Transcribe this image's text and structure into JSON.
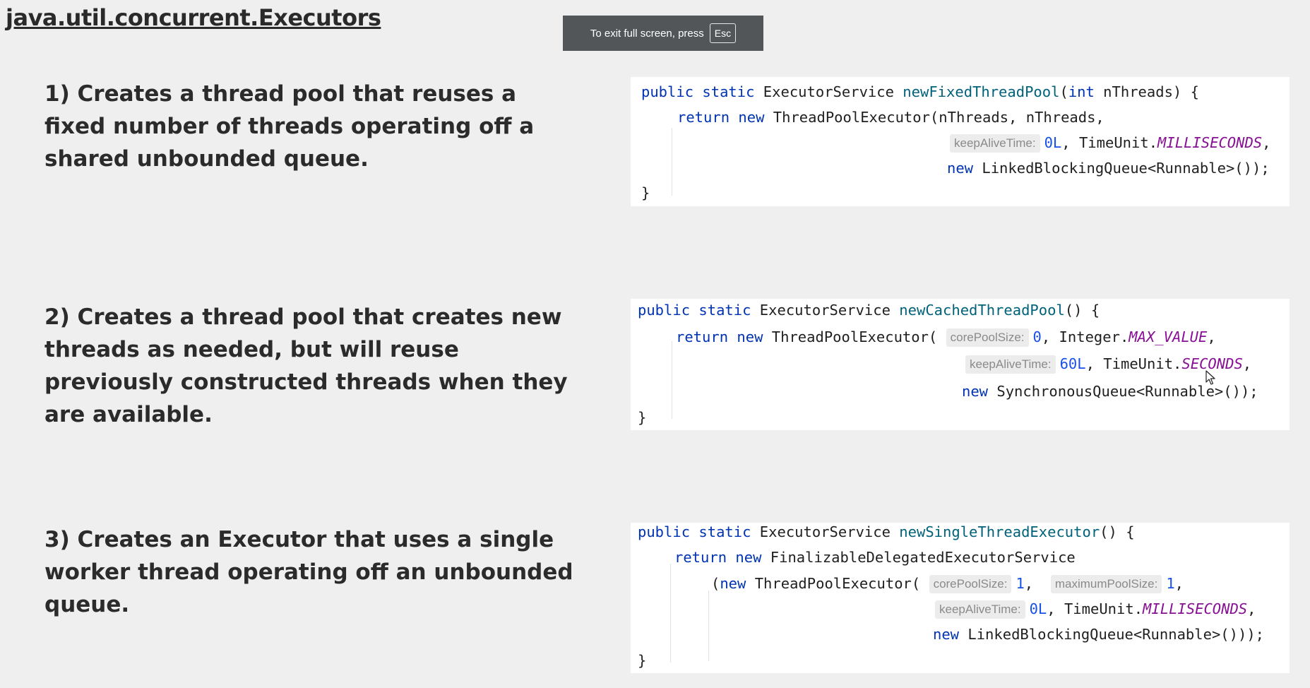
{
  "page": {
    "title": "java.util.concurrent.Executors"
  },
  "fullscreen_banner": {
    "text": "To exit full screen, press",
    "key": "Esc"
  },
  "items": [
    {
      "description": "1) Creates a thread pool that reuses a fixed number of threads operating off a shared unbounded queue.",
      "lines": [
        {
          "t": "public",
          "k": "kw"
        },
        {
          "t": " "
        },
        {
          "t": "static",
          "k": "kw"
        },
        {
          "t": " ExecutorService "
        },
        {
          "t": "newFixedThreadPool",
          "k": "fn"
        },
        {
          "t": "("
        },
        {
          "t": "int",
          "k": "kw"
        },
        {
          "t": " nThreads) {"
        }
      ]
    },
    {
      "description": "2) Creates a thread pool that creates new threads as needed, but will reuse previously constructed threads when they are available."
    },
    {
      "description": "3) Creates an Executor that uses a single worker thread operating off an unbounded queue."
    }
  ],
  "code_blocks": [
    {
      "lines": [
        [
          {
            "t": "public",
            "k": "kw"
          },
          {
            "t": " "
          },
          {
            "t": "static",
            "k": "kw"
          },
          {
            "t": " ExecutorService "
          },
          {
            "t": "newFixedThreadPool",
            "k": "fn"
          },
          {
            "t": "("
          },
          {
            "t": "int",
            "k": "kw"
          },
          {
            "t": " nThreads) {"
          }
        ],
        [
          {
            "t": "return",
            "k": "kw"
          },
          {
            "t": " "
          },
          {
            "t": "new",
            "k": "kw"
          },
          {
            "t": " ThreadPoolExecutor(nThreads, nThreads,"
          }
        ],
        [
          {
            "t": "keepAliveTime:",
            "k": "hint"
          },
          {
            "t": "0L",
            "k": "num"
          },
          {
            "t": ", TimeUnit."
          },
          {
            "t": "MILLISECONDS",
            "k": "const"
          },
          {
            "t": ","
          }
        ],
        [
          {
            "t": "new",
            "k": "kw"
          },
          {
            "t": " LinkedBlockingQueue<Runnable>());"
          }
        ],
        [
          {
            "t": "}"
          }
        ]
      ]
    },
    {
      "lines": [
        [
          {
            "t": "public",
            "k": "kw"
          },
          {
            "t": " "
          },
          {
            "t": "static",
            "k": "kw"
          },
          {
            "t": " ExecutorService "
          },
          {
            "t": "newCachedThreadPool",
            "k": "fn"
          },
          {
            "t": "() {"
          }
        ],
        [
          {
            "t": "return",
            "k": "kw"
          },
          {
            "t": " "
          },
          {
            "t": "new",
            "k": "kw"
          },
          {
            "t": " ThreadPoolExecutor( "
          },
          {
            "t": "corePoolSize:",
            "k": "hint"
          },
          {
            "t": "0",
            "k": "num"
          },
          {
            "t": ", Integer."
          },
          {
            "t": "MAX_VALUE",
            "k": "const"
          },
          {
            "t": ","
          }
        ],
        [
          {
            "t": "keepAliveTime:",
            "k": "hint"
          },
          {
            "t": "60L",
            "k": "num"
          },
          {
            "t": ", TimeUnit."
          },
          {
            "t": "SECONDS",
            "k": "const"
          },
          {
            "t": ","
          }
        ],
        [
          {
            "t": "new",
            "k": "kw"
          },
          {
            "t": " SynchronousQueue<Runnable>());"
          }
        ],
        [
          {
            "t": "}"
          }
        ]
      ]
    },
    {
      "lines": [
        [
          {
            "t": "public",
            "k": "kw"
          },
          {
            "t": " "
          },
          {
            "t": "static",
            "k": "kw"
          },
          {
            "t": " ExecutorService "
          },
          {
            "t": "newSingleThreadExecutor",
            "k": "fn"
          },
          {
            "t": "() {"
          }
        ],
        [
          {
            "t": "return",
            "k": "kw"
          },
          {
            "t": " "
          },
          {
            "t": "new",
            "k": "kw"
          },
          {
            "t": " FinalizableDelegatedExecutorService"
          }
        ],
        [
          {
            "t": "("
          },
          {
            "t": "new",
            "k": "kw"
          },
          {
            "t": " ThreadPoolExecutor( "
          },
          {
            "t": "corePoolSize:",
            "k": "hint"
          },
          {
            "t": "1",
            "k": "num"
          },
          {
            "t": ",  "
          },
          {
            "t": "maximumPoolSize:",
            "k": "hint"
          },
          {
            "t": "1",
            "k": "num"
          },
          {
            "t": ","
          }
        ],
        [
          {
            "t": "keepAliveTime:",
            "k": "hint"
          },
          {
            "t": "0L",
            "k": "num"
          },
          {
            "t": ", TimeUnit."
          },
          {
            "t": "MILLISECONDS",
            "k": "const"
          },
          {
            "t": ","
          }
        ],
        [
          {
            "t": "new",
            "k": "kw"
          },
          {
            "t": " LinkedBlockingQueue<Runnable>()));"
          }
        ],
        [
          {
            "t": "}"
          }
        ]
      ]
    }
  ]
}
